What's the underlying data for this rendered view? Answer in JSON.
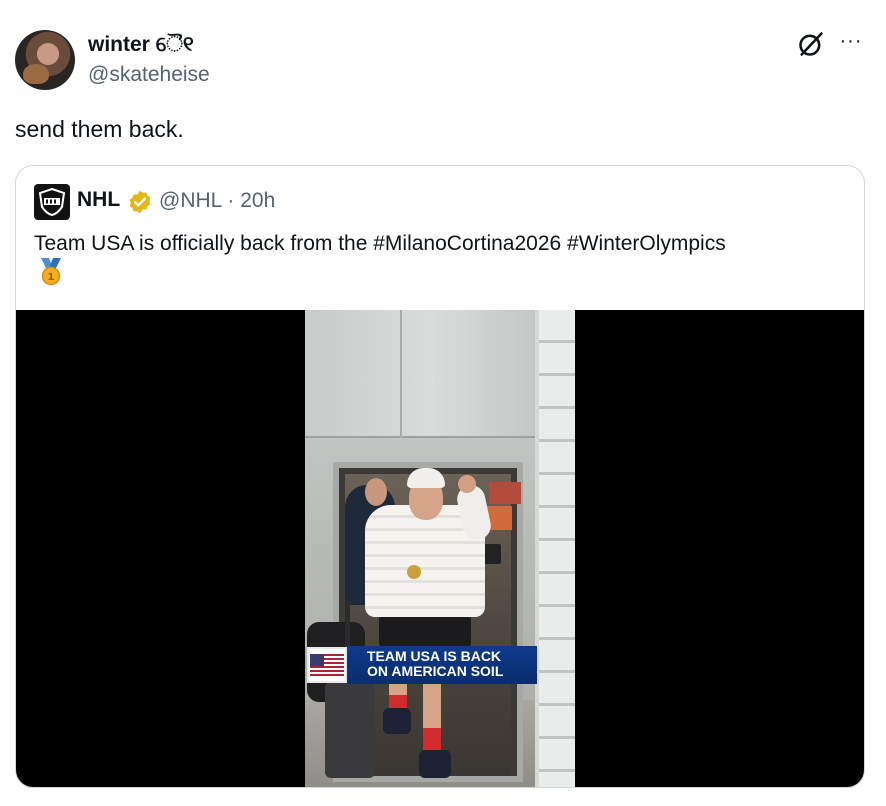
{
  "author": {
    "display_name": "winter",
    "name_emoji": "ୈ୧",
    "handle": "@skateheise"
  },
  "header_actions": {
    "grok_icon": "grok-icon",
    "more_label": "···"
  },
  "tweet_text": "send them back.",
  "quoted_tweet": {
    "display_name": "NHL",
    "verified_badge": "gold-verified-badge-icon",
    "handle_and_time": "@NHL · 20h",
    "text": "Team USA is officially back from the #MilanoCortina2026 #WinterOlympics",
    "medal_emoji": "🥇",
    "video": {
      "overlay_line1": "TEAM USA IS BACK",
      "overlay_line2": "ON AMERICAN SOIL"
    }
  },
  "colors": {
    "text_primary": "#0f1419",
    "text_secondary": "#536471",
    "border": "#cfd9de",
    "verified_gold": "#e2b719",
    "overlay_blue": "#0d3b8c"
  }
}
